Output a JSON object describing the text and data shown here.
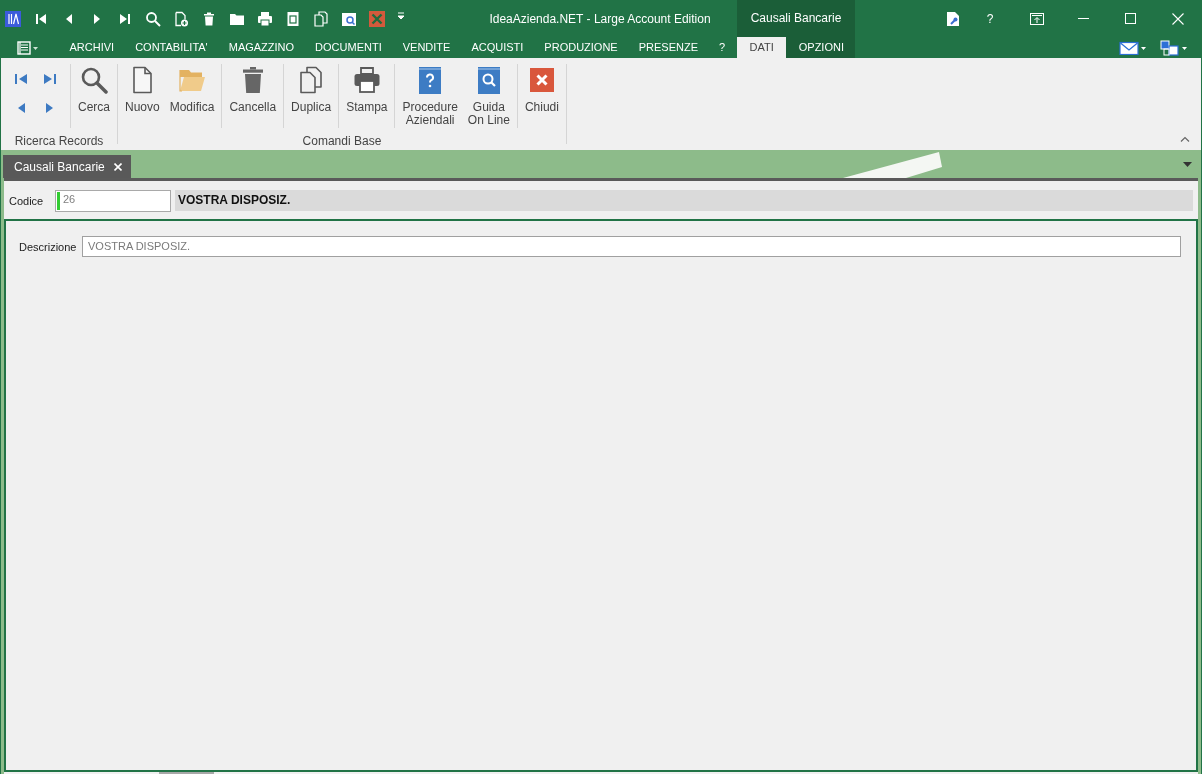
{
  "window": {
    "title": "IdeaAzienda.NET - Large Account Edition",
    "help_button": "?"
  },
  "context_group": {
    "title": "Causali Bancarie",
    "tabs": [
      {
        "label": "DATI",
        "selected": true
      },
      {
        "label": "OPZIONI",
        "selected": false
      }
    ]
  },
  "ribbon_tabs": [
    {
      "label": "ARCHIVI",
      "selected": false
    },
    {
      "label": "CONTABILITA'",
      "selected": false
    },
    {
      "label": "MAGAZZINO",
      "selected": false
    },
    {
      "label": "DOCUMENTI",
      "selected": false
    },
    {
      "label": "VENDITE",
      "selected": false
    },
    {
      "label": "ACQUISTI",
      "selected": false
    },
    {
      "label": "PRODUZIONE",
      "selected": false
    },
    {
      "label": "PRESENZE",
      "selected": false
    },
    {
      "label": "?",
      "selected": false
    }
  ],
  "ribbon_groups": [
    {
      "label": "Ricerca Records",
      "sections": [
        {
          "kind": "nav"
        },
        {
          "kind": "large",
          "buttons": [
            {
              "label": "Cerca"
            }
          ]
        }
      ]
    },
    {
      "label": "Comandi Base",
      "sections": [
        {
          "kind": "large",
          "buttons": [
            {
              "label": "Nuovo"
            },
            {
              "label": "Modifica"
            }
          ]
        },
        {
          "kind": "large",
          "buttons": [
            {
              "label": "Cancella"
            }
          ]
        },
        {
          "kind": "large",
          "buttons": [
            {
              "label": "Duplica"
            }
          ]
        },
        {
          "kind": "large",
          "buttons": [
            {
              "label": "Stampa"
            }
          ]
        },
        {
          "kind": "large",
          "buttons": [
            {
              "label": "Procedure\nAziendali"
            },
            {
              "label": "Guida\nOn Line"
            }
          ]
        },
        {
          "kind": "large",
          "buttons": [
            {
              "label": "Chiudi"
            }
          ]
        }
      ]
    }
  ],
  "document_tabs": [
    {
      "label": "Causali Bancarie",
      "selected": true
    }
  ],
  "record_header": {
    "code_label": "Codice",
    "code_value": "26",
    "description": "VOSTRA DISPOSIZ."
  },
  "form_fields": [
    {
      "label": "Descrizione",
      "value": "VOSTRA DISPOSIZ."
    }
  ]
}
